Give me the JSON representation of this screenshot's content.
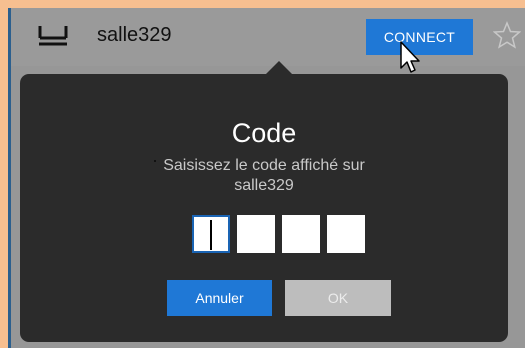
{
  "device": {
    "name": "salle329",
    "connect_label": "CONNECT",
    "icon": "router-icon",
    "favorite_icon": "star-outline-icon"
  },
  "dialog": {
    "title": "Code",
    "message_line1": "Saisissez le code affiché sur",
    "message_line2": "salle329",
    "code_boxes": [
      "",
      "",
      "",
      ""
    ],
    "cancel_label": "Annuler",
    "ok_label": "OK"
  },
  "colors": {
    "accent_blue": "#1f78d6",
    "dialog_bg": "#2b2b2b",
    "panel_bg": "#979797",
    "page_bg": "#f7bf90",
    "ok_disabled": "#bdbdbd"
  }
}
